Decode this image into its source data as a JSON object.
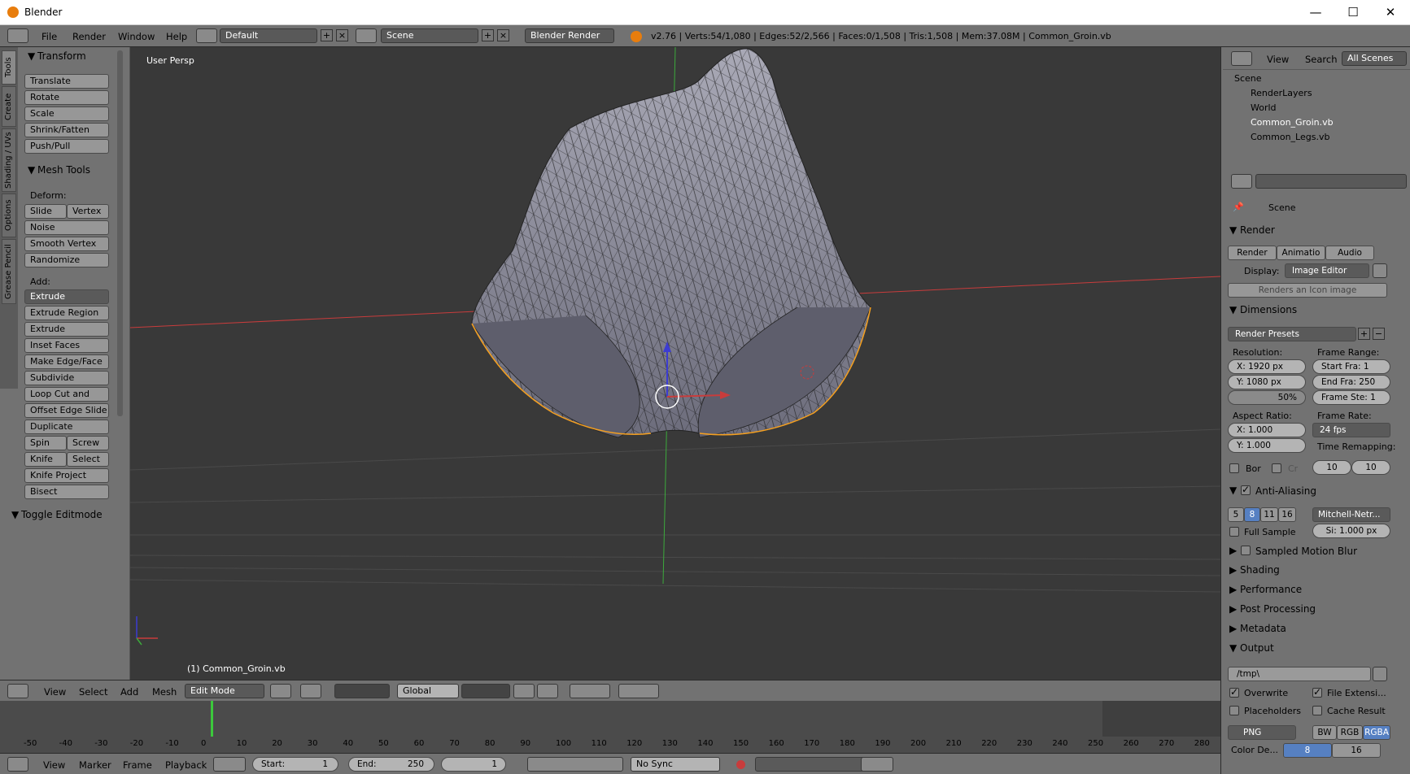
{
  "window": {
    "title": "Blender",
    "minimize": "—",
    "maximize": "☐",
    "close": "✕"
  },
  "info": {
    "menus": [
      "File",
      "Render",
      "Window",
      "Help"
    ],
    "layout": "Default",
    "scene": "Scene",
    "engine": "Blender Render",
    "stats": "v2.76 | Verts:54/1,080 | Edges:52/2,566 | Faces:0/1,508 | Tris:1,508 | Mem:37.08M | Common_Groin.vb"
  },
  "toolshelf": {
    "tabs": [
      "Tools",
      "Create",
      "Shading / UVs",
      "Options",
      "Grease Pencil"
    ],
    "transform_title": "Transform",
    "transform": [
      "Translate",
      "Rotate",
      "Scale",
      "Shrink/Fatten",
      "Push/Pull"
    ],
    "meshtools_title": "Mesh Tools",
    "deform_label": "Deform:",
    "slide_edge": "Slide Ed",
    "vertex": "Vertex",
    "deform": [
      "Noise",
      "Smooth Vertex",
      "Randomize"
    ],
    "add_label": "Add:",
    "extrude": "Extrude",
    "add": [
      "Extrude Region",
      "Extrude Individual",
      "Inset Faces",
      "Make Edge/Face",
      "Subdivide",
      "Loop Cut and Slide",
      "Offset Edge Slide",
      "Duplicate"
    ],
    "spin": "Spin",
    "screw": "Screw",
    "knife": "Knife",
    "select": "Select",
    "more": [
      "Knife Project",
      "Bisect"
    ],
    "toggle": "Toggle Editmode"
  },
  "viewport": {
    "view_label": "User Persp",
    "object_label": "(1) Common_Groin.vb",
    "header": {
      "menus": [
        "View",
        "Select",
        "Add",
        "Mesh"
      ],
      "mode": "Edit Mode",
      "orientation": "Global"
    }
  },
  "timeline": {
    "ticks": [
      "-50",
      "-40",
      "-30",
      "-20",
      "-10",
      "0",
      "10",
      "20",
      "30",
      "40",
      "50",
      "60",
      "70",
      "80",
      "90",
      "100",
      "110",
      "120",
      "130",
      "140",
      "150",
      "160",
      "170",
      "180",
      "190",
      "200",
      "210",
      "220",
      "230",
      "240",
      "250",
      "260",
      "270",
      "280"
    ],
    "menus": [
      "View",
      "Marker",
      "Frame",
      "Playback"
    ],
    "start_label": "Start:",
    "start": "1",
    "end_label": "End:",
    "end": "250",
    "current": "1",
    "sync": "No Sync"
  },
  "outliner": {
    "menus": [
      "View",
      "Search"
    ],
    "filter": "All Scenes",
    "items": [
      "Scene",
      "RenderLayers",
      "World",
      "Common_Groin.vb",
      "Common_Legs.vb"
    ]
  },
  "properties": {
    "context": "Scene",
    "render_title": "Render",
    "render_btn": "Render",
    "anim_btn": "Animatio",
    "audio_btn": "Audio",
    "display_label": "Display:",
    "display": "Image Editor",
    "icon_render": "Renders an Icon image",
    "dimensions_title": "Dimensions",
    "presets": "Render Presets",
    "resolution_label": "Resolution:",
    "res_x": "X:  1920 px",
    "res_y": "Y:  1080 px",
    "res_pct": "50%",
    "frame_range_label": "Frame Range:",
    "start_fra": "Start Fra:  1",
    "end_fra": "End Fra: 250",
    "frame_step": "Frame Ste: 1",
    "aspect_label": "Aspect Ratio:",
    "asp_x": "X:   1.000",
    "asp_y": "Y:   1.000",
    "frame_rate_label": "Frame Rate:",
    "fps": "24 fps",
    "remap_label": "Time Remapping:",
    "remap_old": "10",
    "remap_new": "10",
    "border": "Bor",
    "crop": "Cr",
    "aa_title": "Anti-Aliasing",
    "aa_samples": [
      "5",
      "8",
      "11",
      "16"
    ],
    "aa_filter": "Mitchell-Netr...",
    "full_sample": "Full Sample",
    "filter_size": "Si: 1.000 px",
    "motion_blur": "Sampled Motion Blur",
    "collapsed": [
      "Shading",
      "Performance",
      "Post Processing",
      "Metadata"
    ],
    "output_title": "Output",
    "output_path": "/tmp\\",
    "overwrite": "Overwrite",
    "file_ext": "File Extensi...",
    "placeholders": "Placeholders",
    "cache_result": "Cache Result",
    "format": "PNG",
    "bw": "BW",
    "rgb": "RGB",
    "rgba": "RGBA",
    "color_depth": "Color De...",
    "depth_8": "8",
    "depth_16": "16"
  },
  "colors": {
    "selected_edge": "#f5a020",
    "x_axis": "#c83c3c",
    "y_axis": "#3caa3c",
    "z_axis": "#3c3cd2",
    "selected_button": "#5680c2"
  }
}
